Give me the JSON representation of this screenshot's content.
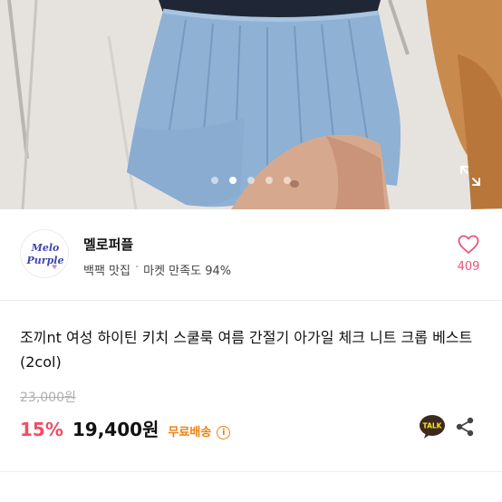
{
  "gallery": {
    "dot_count": 5,
    "active_index": 1,
    "expand_icon": "expand-icon"
  },
  "seller": {
    "logo_line1": "Melo",
    "logo_line2": "Purple",
    "name": "멜로퍼플",
    "badge": "백팩 맛집",
    "separator": "·",
    "satisfaction": "마켓 만족도 94%",
    "likes": "409"
  },
  "product": {
    "title": "조끼nt 여성 하이틴 키치 스쿨룩 여름 간절기 아가일 체크 니트 크롭 베스트(2col)",
    "original_price": "23,000원",
    "discount": "15%",
    "price": "19,400원",
    "shipping": "무료배송",
    "info_icon": "i"
  },
  "colors": {
    "accent_pink": "#e9537b",
    "discount_red": "#f04e63",
    "shipping_orange": "#f07f10",
    "talk_yellow": "#ffe812"
  }
}
